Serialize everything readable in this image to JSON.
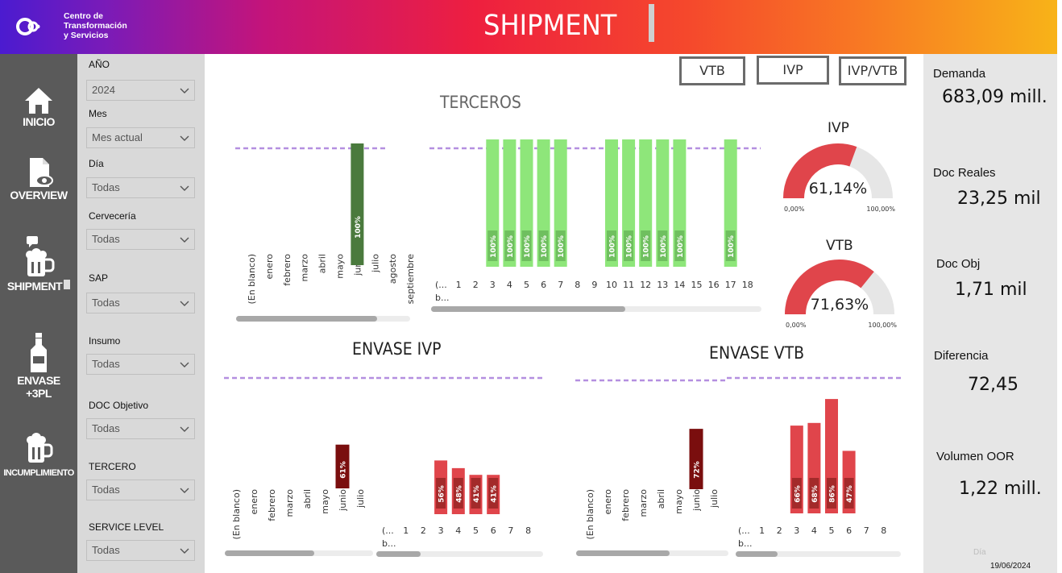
{
  "header": {
    "brand": [
      "Centro de",
      "Transformación",
      "y Servicios"
    ],
    "title": "SHIPMENT",
    "gradient": [
      "#4b1bd0",
      "#ee1f3f",
      "#f8b318"
    ]
  },
  "nav": {
    "items": [
      {
        "label": "INICIO",
        "icon": "home-icon"
      },
      {
        "label": "OVERVIEW",
        "icon": "document-eye-icon"
      },
      {
        "label": "SHIPMENT",
        "icon": "beer-mug-chat-icon"
      },
      {
        "label_line1": "ENVASE",
        "label_line2": "+3PL",
        "icon": "bottle-icon"
      },
      {
        "label": "INCUMPLIMIENTO",
        "icon": "beer-mug-icon"
      }
    ]
  },
  "filters": [
    {
      "label": "AÑO",
      "value": "2024"
    },
    {
      "label": "Mes",
      "value": "Mes actual"
    },
    {
      "label": "Día",
      "value": "Todas"
    },
    {
      "label": "Cervecería",
      "value": "Todas"
    },
    {
      "label": "SAP",
      "value": "Todas"
    },
    {
      "label": "Insumo",
      "value": "Todas"
    },
    {
      "label": "DOC Objetivo",
      "value": "Todas"
    },
    {
      "label": "TERCERO",
      "value": "Todas"
    },
    {
      "label": "SERVICE LEVEL",
      "value": "Todas"
    }
  ],
  "toggles": [
    "VTB",
    "IVP",
    "IVP/VTB"
  ],
  "sections": {
    "terceros": "TERCEROS",
    "envase_ivp": "ENVASE IVP",
    "envase_vtb": "ENVASE VTB"
  },
  "gauges": [
    {
      "title": "IVP",
      "value_label": "61,14%",
      "value": 61.14,
      "min_label": "0,00%",
      "max_label": "100,00%"
    },
    {
      "title": "VTB",
      "value_label": "71,63%",
      "value": 71.63,
      "min_label": "0,00%",
      "max_label": "100,00%"
    }
  ],
  "kpis": [
    {
      "label": "Demanda",
      "value": "683,09 mill."
    },
    {
      "label": "Doc Reales",
      "value": "23,25 mil"
    },
    {
      "label": "Doc Obj",
      "value": "1,71 mil"
    },
    {
      "label": "Diferencia",
      "value": "72,45"
    },
    {
      "label": "Volumen OOR",
      "value": "1,22 mill."
    }
  ],
  "date_filter": {
    "label": "Día",
    "value": "19/06/2024"
  },
  "colors": {
    "green_light": "#8ee67a",
    "green_dark": "#4a7a3d",
    "red": "#e0454b",
    "red_dark": "#7a0e0e",
    "gauge_red": "#e0454b",
    "gauge_bg": "#e6e6e6",
    "target_line": "#b48fe0"
  },
  "chart_data": [
    {
      "id": "terceros_month",
      "type": "bar",
      "categories": [
        "(En blanco)",
        "enero",
        "febrero",
        "marzo",
        "abril",
        "mayo",
        "junio",
        "julio",
        "agosto",
        "septiembre"
      ],
      "values": [
        null,
        null,
        null,
        null,
        null,
        null,
        100,
        null,
        null,
        null
      ],
      "data_labels": [
        "",
        "",
        "",
        "",
        "",
        "",
        "100%",
        "",
        "",
        ""
      ],
      "ylim": [
        0,
        100
      ]
    },
    {
      "id": "terceros_day",
      "type": "bar",
      "categories": [
        "(... b...",
        "1",
        "2",
        "3",
        "4",
        "5",
        "6",
        "7",
        "8",
        "9",
        "10",
        "11",
        "12",
        "13",
        "14",
        "15",
        "16",
        "17",
        "18"
      ],
      "values": [
        null,
        null,
        null,
        100,
        100,
        100,
        100,
        100,
        null,
        null,
        100,
        100,
        100,
        100,
        100,
        null,
        null,
        100,
        null
      ],
      "data_labels": [
        "",
        "",
        "",
        "100%",
        "100%",
        "100%",
        "100%",
        "100%",
        "",
        "",
        "100%",
        "100%",
        "100%",
        "100%",
        "100%",
        "",
        "",
        "100%",
        ""
      ],
      "ylim": [
        0,
        100
      ]
    },
    {
      "id": "envase_ivp_month",
      "type": "bar",
      "categories": [
        "(En blanco)",
        "enero",
        "febrero",
        "marzo",
        "abril",
        "mayo",
        "junio",
        "julio"
      ],
      "values": [
        null,
        null,
        null,
        null,
        null,
        null,
        61,
        null
      ],
      "data_labels": [
        "",
        "",
        "",
        "",
        "",
        "",
        "61%",
        ""
      ],
      "ylim": [
        0,
        100
      ]
    },
    {
      "id": "envase_ivp_day",
      "type": "bar",
      "categories": [
        "(... b...",
        "1",
        "2",
        "3",
        "4",
        "5",
        "6",
        "7",
        "8"
      ],
      "values": [
        null,
        null,
        null,
        56,
        48,
        41,
        41,
        null,
        null
      ],
      "data_labels": [
        "",
        "",
        "",
        "56%",
        "48%",
        "41%",
        "41%",
        "",
        ""
      ],
      "ylim": [
        0,
        100
      ]
    },
    {
      "id": "envase_vtb_month",
      "type": "bar",
      "categories": [
        "(En blanco)",
        "enero",
        "febrero",
        "marzo",
        "abril",
        "mayo",
        "junio",
        "julio"
      ],
      "values": [
        null,
        null,
        null,
        null,
        null,
        null,
        72,
        null
      ],
      "data_labels": [
        "",
        "",
        "",
        "",
        "",
        "",
        "72%",
        ""
      ],
      "ylim": [
        0,
        100
      ]
    },
    {
      "id": "envase_vtb_day",
      "type": "bar",
      "categories": [
        "(... b...",
        "1",
        "2",
        "3",
        "4",
        "5",
        "6",
        "7",
        "8"
      ],
      "values": [
        null,
        null,
        null,
        66,
        68,
        86,
        47,
        null,
        null
      ],
      "data_labels": [
        "",
        "",
        "",
        "66%",
        "68%",
        "86%",
        "47%",
        "",
        ""
      ],
      "ylim": [
        0,
        100
      ]
    }
  ]
}
